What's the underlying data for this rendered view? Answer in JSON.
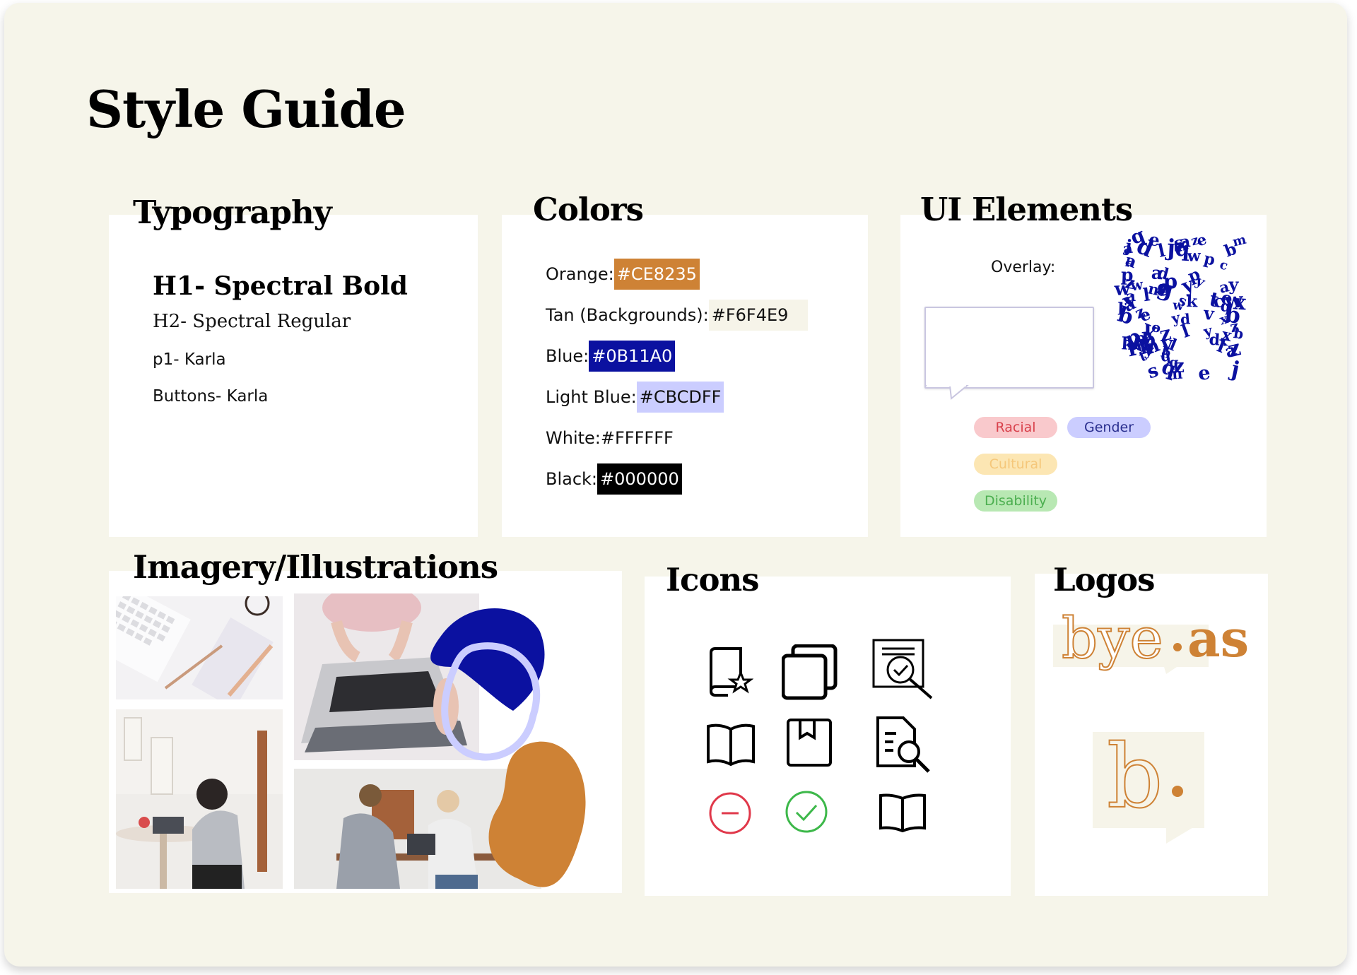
{
  "title": "Style Guide",
  "typography": {
    "heading": "Typography",
    "h1": "H1- Spectral Bold",
    "h2": "H2- Spectral Regular",
    "p1": "p1- Karla",
    "buttons": "Buttons- Karla"
  },
  "colors": {
    "heading": "Colors",
    "items": [
      {
        "label": "Orange:",
        "code": "#CE8235",
        "bg": "#CE8235",
        "fg": "#ffffff"
      },
      {
        "label": "Tan (Backgrounds):",
        "code": "#F6F4E9",
        "bg": "#F6F4E9",
        "fg": "#111111"
      },
      {
        "label": "Blue:",
        "code": "#0B11A0",
        "bg": "#0B11A0",
        "fg": "#ffffff"
      },
      {
        "label": "Light Blue:",
        "code": "#CBCDFF",
        "bg": "#CBCDFF",
        "fg": "#111111"
      },
      {
        "label": "White:",
        "code": "#FFFFFF",
        "bg": "#FFFFFF",
        "fg": "#111111"
      },
      {
        "label": "Black:",
        "code": "#000000",
        "bg": "#000000",
        "fg": "#ffffff"
      }
    ]
  },
  "ui_elements": {
    "heading": "UI Elements",
    "overlay_label": "Overlay:",
    "tags": [
      {
        "label": "Racial",
        "bg": "#F9C9CC",
        "fg": "#D9414C"
      },
      {
        "label": "Gender",
        "bg": "#CBCDFF",
        "fg": "#2A2F8F"
      },
      {
        "label": "Cultural",
        "bg": "#FCE6B3",
        "fg": "#F5C77A"
      },
      {
        "label": "Disability",
        "bg": "#B8E8B3",
        "fg": "#4CAF50"
      }
    ]
  },
  "imagery": {
    "heading": "Imagery/Illustrations",
    "blob_colors": {
      "blue": "#0B11A0",
      "orange": "#CE8235",
      "ring": "#CBCDFF"
    }
  },
  "icons": {
    "heading": "Icons",
    "names": [
      "book-star-icon",
      "copy-icon",
      "document-search-icon",
      "open-book-icon",
      "bookmark-icon",
      "file-search-icon",
      "minus-circle-icon",
      "check-circle-icon",
      "book-icon"
    ],
    "minus_color": "#E0384A",
    "check_color": "#3DB84A"
  },
  "logos": {
    "heading": "Logos",
    "wordmark": "bye·as",
    "part1": "bye",
    "part2": "as",
    "monogram": "b",
    "orange": "#CE8235",
    "tan": "#F6F4E9"
  }
}
